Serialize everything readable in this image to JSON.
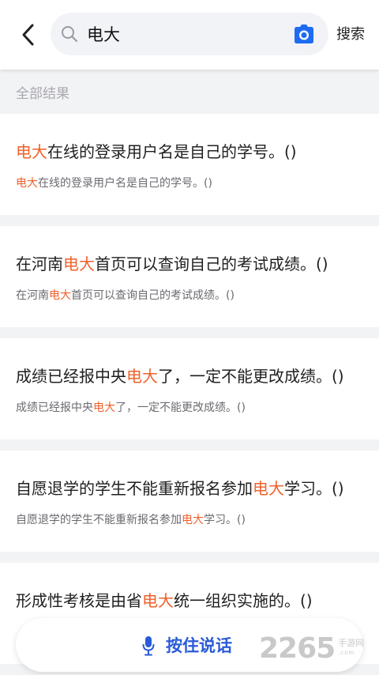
{
  "colors": {
    "accent_blue": "#2a5bd7",
    "highlight_orange": "#f0602a",
    "background": "#f2f3f5"
  },
  "header": {
    "back_icon": "chevron-left-icon",
    "search": {
      "icon": "search-icon",
      "value": "电大"
    },
    "camera_icon": "camera-icon",
    "search_button": "搜索"
  },
  "section_label": "全部结果",
  "results": [
    {
      "title_pre": "",
      "title_hl": "电大",
      "title_post": "在线的登录用户名是自己的学号。()",
      "sub_pre": "",
      "sub_hl": "电大",
      "sub_post": "在线的登录用户名是自己的学号。()"
    },
    {
      "title_pre": "在河南",
      "title_hl": "电大",
      "title_post": "首页可以查询自己的考试成绩。()",
      "sub_pre": "在河南",
      "sub_hl": "电大",
      "sub_post": "首页可以查询自己的考试成绩。()"
    },
    {
      "title_pre": "成绩已经报中央",
      "title_hl": "电大",
      "title_post": "了，一定不能更改成绩。()",
      "sub_pre": "成绩已经报中央",
      "sub_hl": "电大",
      "sub_post": "了，一定不能更改成绩。()"
    },
    {
      "title_pre": "自愿退学的学生不能重新报名参加",
      "title_hl": "电大",
      "title_post": "学习。()",
      "sub_pre": "自愿退学的学生不能重新报名参加",
      "sub_hl": "电大",
      "sub_post": "学习。()"
    },
    {
      "title_pre": "形成性考核是由省",
      "title_hl": "电大",
      "title_post": "统一组织实施的。()",
      "sub_pre": "",
      "sub_hl": "",
      "sub_post": ""
    }
  ],
  "voice": {
    "icon": "microphone-icon",
    "label": "按住说话"
  },
  "watermark": {
    "number": "2265",
    "text": "手游网",
    "sub": ".com"
  }
}
